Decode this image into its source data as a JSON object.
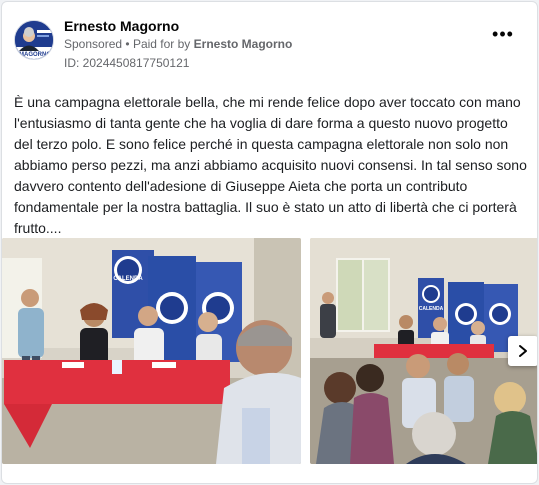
{
  "post": {
    "author": "Ernesto Magorno",
    "sponsored_label": "Sponsored",
    "separator": "•",
    "paid_for_prefix": "Paid for by",
    "paid_for_name": "Ernesto Magorno",
    "id_text": "ID: 2024450817750121",
    "more_label": "•••",
    "body": "È una campagna elettorale bella, che mi rende felice dopo aver toccato con mano l'entusiasmo di tanta gente che ha voglia di dare forma a questo nuovo progetto del terzo polo. E sono felice perché in questa campagna elettorale non solo non abbiamo perso pezzi, ma anzi abbiamo acquisito nuovi consensi. In tal senso sono davvero contento dell'adesione di Giuseppe Aieta che porta un contributo fondamentale per la nostra battaglia. Il suo è stato un atto di libertà che ci porterà frutto...."
  },
  "avatar": {
    "logo_text": "MAGORNO"
  },
  "photos": [
    {
      "banner_text": "CALENDA"
    },
    {
      "banner_text": "CALENDA"
    }
  ],
  "icons": {
    "more": "more-options-icon",
    "next": "chevron-right-icon"
  },
  "colors": {
    "accent_blue": "#1f3c8f",
    "tablecloth_red": "#e0303f",
    "meta_gray": "#65676b"
  }
}
